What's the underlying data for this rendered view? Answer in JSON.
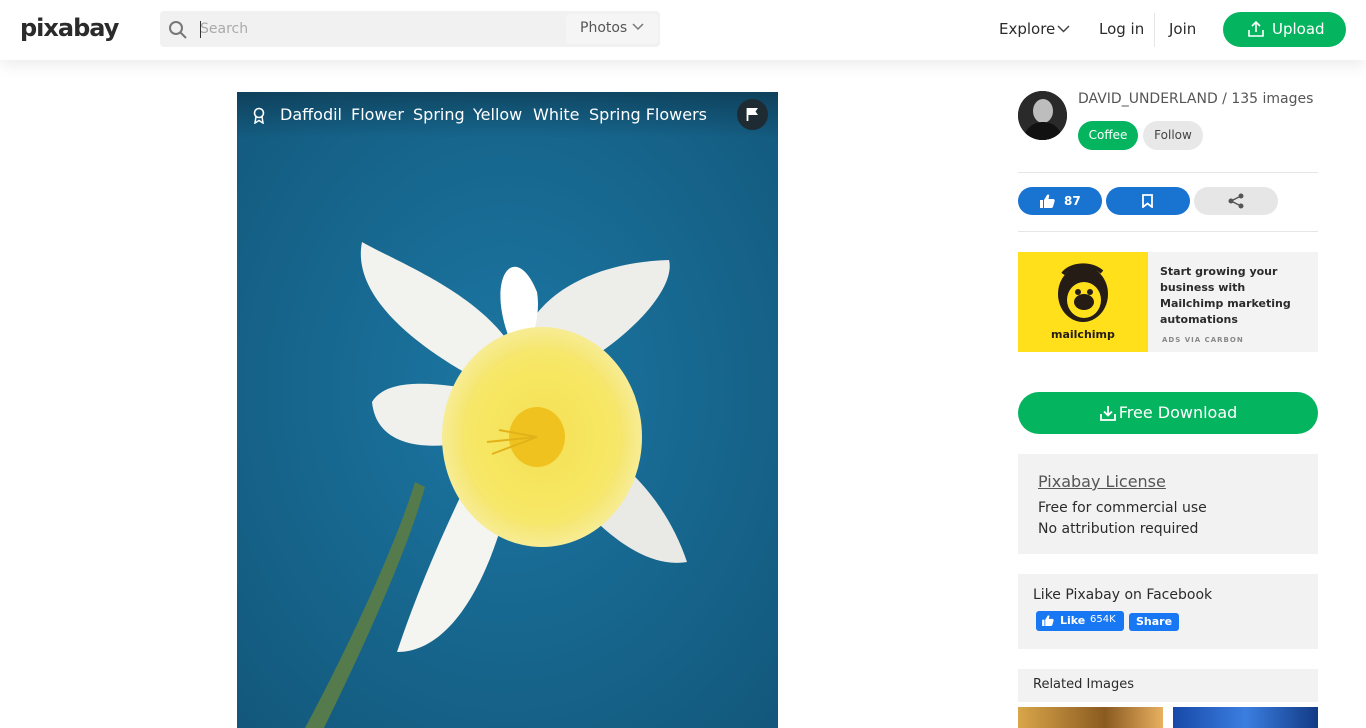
{
  "header": {
    "logo": "pixabay",
    "search": {
      "placeholder": "Search",
      "type": "Photos"
    },
    "nav": {
      "explore": "Explore",
      "login": "Log in",
      "join": "Join",
      "upload": "Upload"
    }
  },
  "photo": {
    "tags": [
      "Daffodil",
      "Flower",
      "Spring",
      "Yellow",
      "White",
      "Spring Flowers"
    ]
  },
  "sidebar": {
    "author": "DAVID_UNDERLAND / 135 images",
    "coffee": "Coffee",
    "follow": "Follow",
    "likes": "87",
    "ad": {
      "brand": "mailchimp",
      "text": "Start growing your business with Mailchimp marketing automations",
      "via": "ADS VIA CARBON"
    },
    "download": "Free Download",
    "license": {
      "title": "Pixabay License",
      "line1": "Free for commercial use",
      "line2": "No attribution required"
    },
    "facebook": {
      "title": "Like Pixabay on Facebook",
      "like": "Like",
      "count": "654K",
      "share": "Share"
    },
    "related": "Related Images"
  },
  "colors": {
    "brand_green": "#05b45f",
    "like_blue": "#1873d1",
    "facebook_blue": "#1877f2",
    "photo_background": "#1a6a91"
  },
  "icons": [
    "search-icon",
    "chevron-down-icon",
    "upload-icon",
    "award-icon",
    "flag-icon",
    "thumbs-up-icon",
    "bookmark-icon",
    "share-icon",
    "download-icon"
  ]
}
